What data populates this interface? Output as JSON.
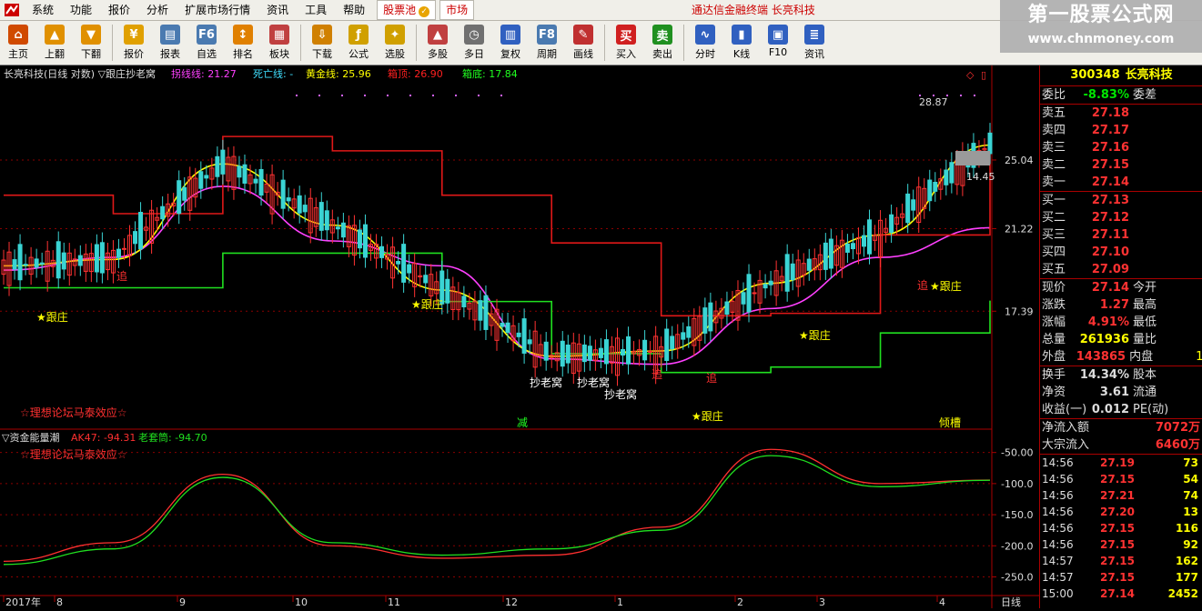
{
  "menubar": {
    "items": [
      "系统",
      "功能",
      "报价",
      "分析",
      "扩展市场行情",
      "资讯",
      "工具",
      "帮助"
    ],
    "tab_pool": "股票池",
    "tab_market": "市场",
    "terminal_title": "通达信金融终端  长亮科技"
  },
  "banner": {
    "line1": "第一股票公式网",
    "line2": "www.chnmoney.com"
  },
  "toolbar": [
    {
      "label": "主页",
      "icon": "home-icon",
      "color": "#d04a00"
    },
    {
      "label": "上翻",
      "icon": "arrow-up-icon",
      "color": "#e09000"
    },
    {
      "label": "下翻",
      "icon": "arrow-down-icon",
      "color": "#e09000"
    },
    {
      "label": "报价",
      "icon": "yen-icon",
      "color": "#e0a000"
    },
    {
      "label": "报表",
      "icon": "report-icon",
      "color": "#4a7ab0"
    },
    {
      "label": "自选",
      "icon": "f6-icon",
      "color": "#4a7ab0"
    },
    {
      "label": "排名",
      "icon": "ranking-icon",
      "color": "#e08000"
    },
    {
      "label": "板块",
      "icon": "sector-icon",
      "color": "#c04040"
    },
    {
      "label": "下载",
      "icon": "download-icon",
      "color": "#d08000"
    },
    {
      "label": "公式",
      "icon": "formula-icon",
      "color": "#d0a000"
    },
    {
      "label": "选股",
      "icon": "stock-picker-icon",
      "color": "#d0a000"
    },
    {
      "label": "多股",
      "icon": "multi-stock-icon",
      "color": "#c04040"
    },
    {
      "label": "多日",
      "icon": "multi-day-icon",
      "color": "#707070"
    },
    {
      "label": "复权",
      "icon": "restore-icon",
      "color": "#3060c0"
    },
    {
      "label": "周期",
      "icon": "f8-icon",
      "color": "#4a7ab0"
    },
    {
      "label": "画线",
      "icon": "draw-line-icon",
      "color": "#c03030"
    },
    {
      "label": "买入",
      "icon": "buy-icon",
      "color": "#d02020"
    },
    {
      "label": "卖出",
      "icon": "sell-icon",
      "color": "#209020"
    },
    {
      "label": "分时",
      "icon": "intraday-icon",
      "color": "#3060c0"
    },
    {
      "label": "K线",
      "icon": "kline-icon",
      "color": "#3060c0"
    },
    {
      "label": "F10",
      "icon": "f10-icon",
      "color": "#3060c0"
    },
    {
      "label": "资讯",
      "icon": "news-icon",
      "color": "#3060c0"
    }
  ],
  "upper_chart": {
    "title": "长亮科技(日线 对数) ▽跟庄抄老窝",
    "legend": [
      {
        "label": "拐线线: 21.27",
        "color": "#ff40ff"
      },
      {
        "label": "死亡线: -",
        "color": "#40e0ff"
      },
      {
        "label": "黄金线: 25.96",
        "color": "#ffff00"
      },
      {
        "label": "箱顶: 26.90",
        "color": "#ff2020"
      },
      {
        "label": "箱底: 17.84",
        "color": "#20ff20"
      }
    ],
    "price_axis": [
      "25.04",
      "21.22",
      "17.39"
    ],
    "high_label": "28.87",
    "low_label": "14.45",
    "watermark": "☆理想论坛马泰效应☆",
    "annotations": [
      "跟庄",
      "跟庄",
      "抄老窝",
      "抄老窝",
      "抄老窝",
      "跟庄",
      "跟庄",
      "跟庄",
      "追",
      "追",
      "追",
      "追",
      "减",
      "倾槽"
    ]
  },
  "lower_chart": {
    "title": "▽资金能量潮",
    "ak47": "AK47: -94.31",
    "laocang": "老套筒: -94.70",
    "watermark": "☆理想论坛马泰效应☆",
    "axis": [
      "-50.00",
      "-100.0",
      "-150.0",
      "-200.0",
      "-250.0"
    ]
  },
  "date_axis": [
    "2017年",
    "8",
    "9",
    "10",
    "11",
    "12",
    "1",
    "2",
    "3",
    "4"
  ],
  "period_label": "日线",
  "chart_data": [
    {
      "type": "line",
      "title": "",
      "log_scale": true,
      "x": [
        "2017-07",
        "2017-08",
        "2017-09",
        "2017-10",
        "2017-11",
        "2017-12",
        "2018-01",
        "2018-02",
        "2018-03",
        "2018-04"
      ],
      "yticks": [
        25.04,
        21.22,
        17.39
      ],
      "series": [
        {
          "name": "拐线线",
          "values": [
            19.2,
            19.8,
            23.5,
            20.6,
            19.4,
            15.5,
            15.3,
            17.5,
            19.8,
            21.27
          ]
        },
        {
          "name": "黄金线",
          "values": [
            19.4,
            19.7,
            24.8,
            21.4,
            18.3,
            15.6,
            15.8,
            18.6,
            20.9,
            25.96
          ]
        },
        {
          "name": "箱顶",
          "values": [
            23.0,
            22.0,
            26.5,
            25.6,
            23.0,
            20.5,
            17.2,
            17.3,
            20.9,
            26.9
          ]
        },
        {
          "name": "箱底",
          "values": [
            18.4,
            18.4,
            20.0,
            20.0,
            17.8,
            15.7,
            15.0,
            15.2,
            16.5,
            17.84
          ]
        }
      ],
      "annotations": [
        "28.87",
        "14.45"
      ]
    },
    {
      "type": "line",
      "title": "▽资金能量潮",
      "x": [
        "2017-07",
        "2017-08",
        "2017-09",
        "2017-10",
        "2017-11",
        "2017-12",
        "2018-01",
        "2018-02",
        "2018-03",
        "2018-04"
      ],
      "ylim": [
        -280,
        -30
      ],
      "series": [
        {
          "name": "AK47",
          "values": [
            -225,
            -195,
            -85,
            -200,
            -220,
            -215,
            -170,
            -45,
            -100,
            -94.31
          ]
        },
        {
          "name": "老套筒",
          "values": [
            -230,
            -205,
            -90,
            -195,
            -215,
            -205,
            -175,
            -55,
            -105,
            -94.7
          ]
        }
      ]
    }
  ],
  "quote": {
    "code": "300348",
    "name": "长亮科技",
    "ratio_label": "委比",
    "ratio": "-8.83%",
    "ratio_right": "委差",
    "asks": [
      {
        "label": "卖五",
        "price": "27.18"
      },
      {
        "label": "卖四",
        "price": "27.17"
      },
      {
        "label": "卖三",
        "price": "27.16"
      },
      {
        "label": "卖二",
        "price": "27.15"
      },
      {
        "label": "卖一",
        "price": "27.14"
      }
    ],
    "bids": [
      {
        "label": "买一",
        "price": "27.13"
      },
      {
        "label": "买二",
        "price": "27.12"
      },
      {
        "label": "买三",
        "price": "27.11"
      },
      {
        "label": "买四",
        "price": "27.10"
      },
      {
        "label": "买五",
        "price": "27.09"
      }
    ],
    "stats1": [
      {
        "label": "现价",
        "value": "27.14",
        "right": "今开",
        "color": "red"
      },
      {
        "label": "涨跌",
        "value": "1.27",
        "right": "最高",
        "color": "red"
      },
      {
        "label": "涨幅",
        "value": "4.91%",
        "right": "最低",
        "color": "red"
      },
      {
        "label": "总量",
        "value": "261936",
        "right": "量比",
        "color": "yel"
      },
      {
        "label": "外盘",
        "value": "143865",
        "right": "内盘",
        "color": "red"
      }
    ],
    "inner_value": "1",
    "stats2": [
      {
        "label": "换手",
        "value": "14.34%",
        "right": "股本"
      },
      {
        "label": "净资",
        "value": "3.61",
        "right": "流通"
      },
      {
        "label": "收益(一)",
        "value": "0.012",
        "right": "PE(动)"
      }
    ],
    "flows": [
      {
        "label": "净流入额",
        "value": "7072万"
      },
      {
        "label": "大宗流入",
        "value": "6460万"
      }
    ],
    "ticks": [
      {
        "time": "14:56",
        "price": "27.19",
        "vol": "73"
      },
      {
        "time": "14:56",
        "price": "27.15",
        "vol": "54"
      },
      {
        "time": "14:56",
        "price": "27.21",
        "vol": "74"
      },
      {
        "time": "14:56",
        "price": "27.20",
        "vol": "13"
      },
      {
        "time": "14:56",
        "price": "27.15",
        "vol": "116"
      },
      {
        "time": "14:56",
        "price": "27.15",
        "vol": "92"
      },
      {
        "time": "14:57",
        "price": "27.15",
        "vol": "162"
      },
      {
        "time": "14:57",
        "price": "27.15",
        "vol": "177"
      },
      {
        "time": "15:00",
        "price": "27.14",
        "vol": "2452"
      }
    ]
  }
}
